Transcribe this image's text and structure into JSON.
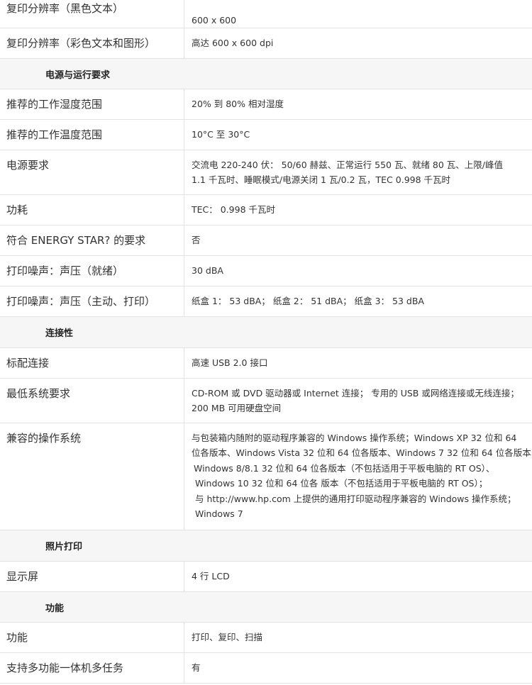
{
  "spec_rows": [
    {
      "type": "row",
      "label": "复印分辨率（黑色文本）",
      "lines": [
        "",
        "600 x 600"
      ]
    },
    {
      "type": "row",
      "label": "复印分辨率（彩色文本和图形）",
      "lines": [
        "高达 600 x 600 dpi"
      ]
    },
    {
      "type": "section",
      "title": "电源与运行要求"
    },
    {
      "type": "row",
      "label": "推荐的工作湿度范围",
      "lines": [
        "20% 到 80% 相对湿度"
      ]
    },
    {
      "type": "row",
      "label": "推荐的工作温度范围",
      "lines": [
        "10°C 至 30°C"
      ]
    },
    {
      "type": "row",
      "label": "电源要求",
      "lines": [
        "交流电 220-240 伏： 50/60 赫兹、正常运行 550 瓦、就绪 80 瓦、上限/峰值",
        "1.1 千瓦时、睡眠模式/电源关闭 1 瓦/0.2 瓦，TEC 0.998  千瓦时"
      ]
    },
    {
      "type": "row",
      "label": "功耗",
      "lines": [
        "TEC： 0.998 千瓦时"
      ]
    },
    {
      "type": "row",
      "label": "符合 ENERGY STAR? 的要求",
      "lines": [
        "否"
      ]
    },
    {
      "type": "row",
      "label": "打印噪声：声压（就绪）",
      "lines": [
        "30 dBA"
      ]
    },
    {
      "type": "row",
      "label": "打印噪声：声压（主动、打印）",
      "lines": [
        "纸盒 1： 53 dBA； 纸盒 2： 51 dBA； 纸盒 3： 53 dBA"
      ]
    },
    {
      "type": "section",
      "title": "连接性"
    },
    {
      "type": "row",
      "label": "标配连接",
      "lines": [
        "高速 USB 2.0 接口"
      ]
    },
    {
      "type": "row",
      "label": "最低系统要求",
      "lines": [
        "CD-ROM 或 DVD 驱动器或 Internet 连接； 专用的 USB 或网络连接或无线连接；",
        "200 MB 可用硬盘空间"
      ]
    },
    {
      "type": "row",
      "label": "兼容的操作系统",
      "os": true,
      "lines": [
        "与包装箱内随附的驱动程序兼容的 Windows 操作系统；Windows XP 32 位和 64",
        "位各版本、Windows Vista 32 位和 64 位各版本、Windows 7 32 位和 64 位各版本、",
        "Windows 8/8.1 32 位和 64 位各版本（不包括适用于平板电脑的 RT OS）、",
        "Windows 10 32 位和 64 位各 版本（不包括适用于平板电脑的 RT OS）；",
        "与 http://www.hp.com 上提供的通用打印驱动程序兼容的 Windows 操作系统；",
        "Windows 7"
      ]
    },
    {
      "type": "section",
      "title": "照片打印"
    },
    {
      "type": "row",
      "label": "显示屏",
      "lines": [
        "4 行 LCD"
      ]
    },
    {
      "type": "section",
      "title": "功能"
    },
    {
      "type": "row",
      "label": "功能",
      "lines": [
        "打印、复印、扫描"
      ]
    },
    {
      "type": "row",
      "label": "支持多功能一体机多任务",
      "lines": [
        "有"
      ]
    }
  ]
}
